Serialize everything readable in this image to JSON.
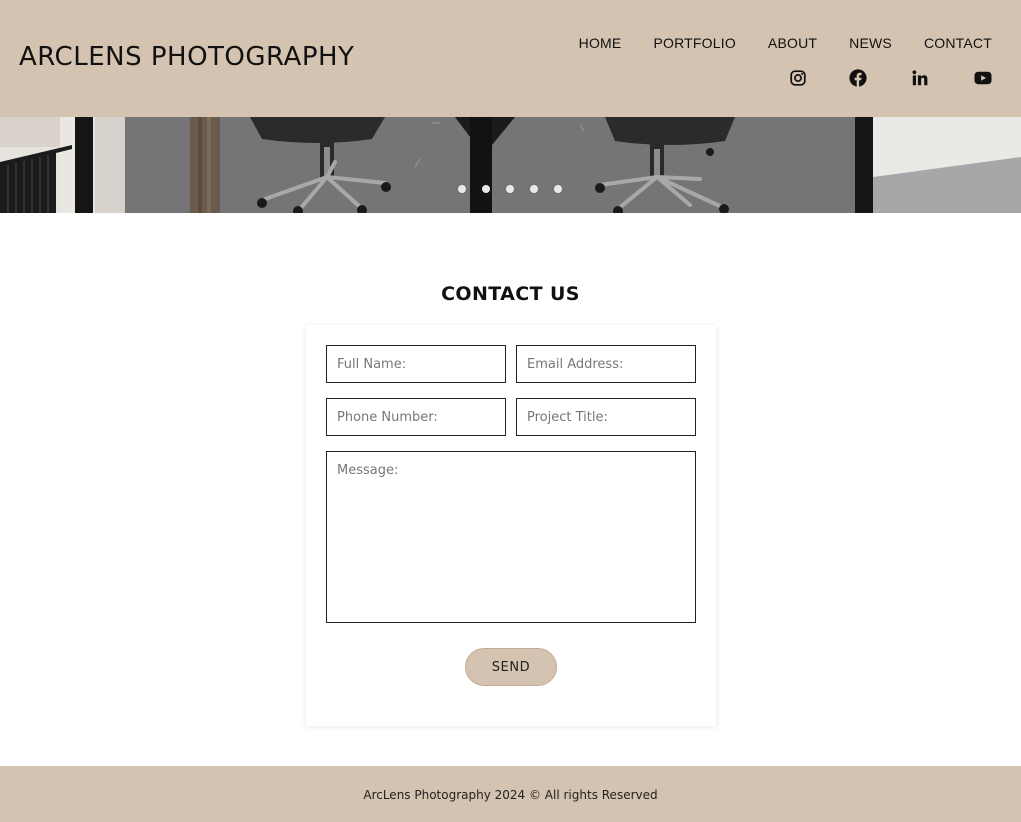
{
  "brand": {
    "logo_text": "ARCLENS PHOTOGRAPHY"
  },
  "nav": {
    "items": [
      {
        "label": "HOME"
      },
      {
        "label": "PORTFOLIO"
      },
      {
        "label": "ABOUT"
      },
      {
        "label": "NEWS"
      },
      {
        "label": "CONTACT"
      }
    ]
  },
  "social": {
    "icons": [
      "instagram-icon",
      "facebook-icon",
      "linkedin-icon",
      "youtube-icon"
    ]
  },
  "hero": {
    "slide_count": 5,
    "active_slide": 2
  },
  "contact": {
    "title": "CONTACT US",
    "fields": {
      "full_name": {
        "placeholder": "Full Name:",
        "value": ""
      },
      "email": {
        "placeholder": "Email Address:",
        "value": ""
      },
      "phone": {
        "placeholder": "Phone Number:",
        "value": ""
      },
      "project_title": {
        "placeholder": "Project Title:",
        "value": ""
      },
      "message": {
        "placeholder": "Message:",
        "value": ""
      }
    },
    "send_label": "SEND"
  },
  "footer": {
    "text": "ArcLens Photography 2024 © All rights Reserved"
  },
  "colors": {
    "accent": "#d4c3b0",
    "text": "#111111",
    "background": "#ffffff"
  }
}
